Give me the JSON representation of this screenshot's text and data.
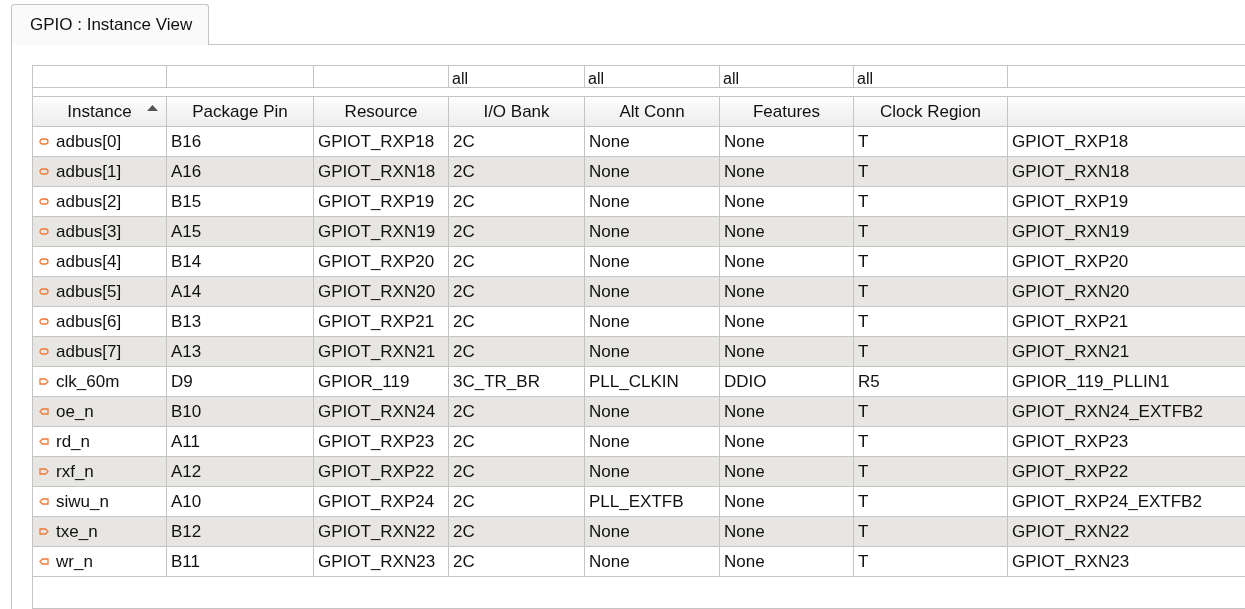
{
  "tab": {
    "label": "GPIO : Instance View",
    "selected": true
  },
  "columns": [
    {
      "label": "Instance",
      "sorted": true
    },
    {
      "label": "Package Pin",
      "sorted": false
    },
    {
      "label": "Resource",
      "sorted": false
    },
    {
      "label": "I/O Bank",
      "sorted": false,
      "filter": "all"
    },
    {
      "label": "Alt Conn",
      "sorted": false,
      "filter": "all"
    },
    {
      "label": "Features",
      "sorted": false,
      "filter": "all"
    },
    {
      "label": "Clock Region",
      "sorted": false,
      "filter": "all"
    }
  ],
  "rows": [
    {
      "kind": "inout",
      "cells": [
        "adbus[0]",
        "B16",
        "GPIOT_RXP18",
        "2C",
        "None",
        "None",
        "T",
        "GPIOT_RXP18"
      ]
    },
    {
      "kind": "inout",
      "cells": [
        "adbus[1]",
        "A16",
        "GPIOT_RXN18",
        "2C",
        "None",
        "None",
        "T",
        "GPIOT_RXN18"
      ]
    },
    {
      "kind": "inout",
      "cells": [
        "adbus[2]",
        "B15",
        "GPIOT_RXP19",
        "2C",
        "None",
        "None",
        "T",
        "GPIOT_RXP19"
      ]
    },
    {
      "kind": "inout",
      "cells": [
        "adbus[3]",
        "A15",
        "GPIOT_RXN19",
        "2C",
        "None",
        "None",
        "T",
        "GPIOT_RXN19"
      ]
    },
    {
      "kind": "inout",
      "cells": [
        "adbus[4]",
        "B14",
        "GPIOT_RXP20",
        "2C",
        "None",
        "None",
        "T",
        "GPIOT_RXP20"
      ]
    },
    {
      "kind": "inout",
      "cells": [
        "adbus[5]",
        "A14",
        "GPIOT_RXN20",
        "2C",
        "None",
        "None",
        "T",
        "GPIOT_RXN20"
      ]
    },
    {
      "kind": "inout",
      "cells": [
        "adbus[6]",
        "B13",
        "GPIOT_RXP21",
        "2C",
        "None",
        "None",
        "T",
        "GPIOT_RXP21"
      ]
    },
    {
      "kind": "inout",
      "cells": [
        "adbus[7]",
        "A13",
        "GPIOT_RXN21",
        "2C",
        "None",
        "None",
        "T",
        "GPIOT_RXN21"
      ]
    },
    {
      "kind": "input",
      "cells": [
        "clk_60m",
        "D9",
        "GPIOR_119",
        "3C_TR_BR",
        "PLL_CLKIN",
        "DDIO",
        "R5",
        "GPIOR_119_PLLIN1"
      ]
    },
    {
      "kind": "output",
      "cells": [
        "oe_n",
        "B10",
        "GPIOT_RXN24",
        "2C",
        "None",
        "None",
        "T",
        "GPIOT_RXN24_EXTFB2"
      ]
    },
    {
      "kind": "output",
      "cells": [
        "rd_n",
        "A11",
        "GPIOT_RXP23",
        "2C",
        "None",
        "None",
        "T",
        "GPIOT_RXP23"
      ]
    },
    {
      "kind": "input",
      "cells": [
        "rxf_n",
        "A12",
        "GPIOT_RXP22",
        "2C",
        "None",
        "None",
        "T",
        "GPIOT_RXP22"
      ]
    },
    {
      "kind": "output",
      "cells": [
        "siwu_n",
        "A10",
        "GPIOT_RXP24",
        "2C",
        "PLL_EXTFB",
        "None",
        "T",
        "GPIOT_RXP24_EXTFB2"
      ]
    },
    {
      "kind": "input",
      "cells": [
        "txe_n",
        "B12",
        "GPIOT_RXN22",
        "2C",
        "None",
        "None",
        "T",
        "GPIOT_RXN22"
      ]
    },
    {
      "kind": "output",
      "cells": [
        "wr_n",
        "B11",
        "GPIOT_RXN23",
        "2C",
        "None",
        "None",
        "T",
        "GPIOT_RXN23"
      ]
    }
  ]
}
